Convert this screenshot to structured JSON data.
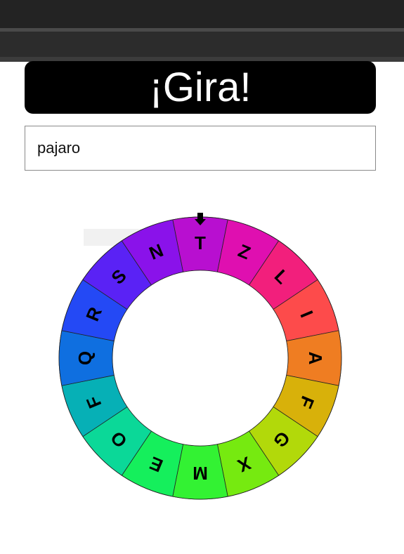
{
  "header": {
    "title": "¡Gira!"
  },
  "input": {
    "value": "pajaro"
  },
  "wheel": {
    "pointer_icon": "arrow-down-icon",
    "segments": [
      {
        "letter": "T",
        "color": "#b80fd0"
      },
      {
        "letter": "Z",
        "color": "#df0fb0"
      },
      {
        "letter": "L",
        "color": "#f21f7c"
      },
      {
        "letter": "I",
        "color": "#fd4b4b"
      },
      {
        "letter": "A",
        "color": "#ef7d22"
      },
      {
        "letter": "F",
        "color": "#d8b10a"
      },
      {
        "letter": "G",
        "color": "#b2d90a"
      },
      {
        "letter": "X",
        "color": "#76ea10"
      },
      {
        "letter": "M",
        "color": "#33f233"
      },
      {
        "letter": "E",
        "color": "#15ef5c"
      },
      {
        "letter": "O",
        "color": "#0bd898"
      },
      {
        "letter": "F",
        "color": "#06b0b6"
      },
      {
        "letter": "Q",
        "color": "#0f6fe0"
      },
      {
        "letter": "R",
        "color": "#2449f5"
      },
      {
        "letter": "S",
        "color": "#5a22f5"
      },
      {
        "letter": "N",
        "color": "#8a12ea"
      }
    ]
  }
}
